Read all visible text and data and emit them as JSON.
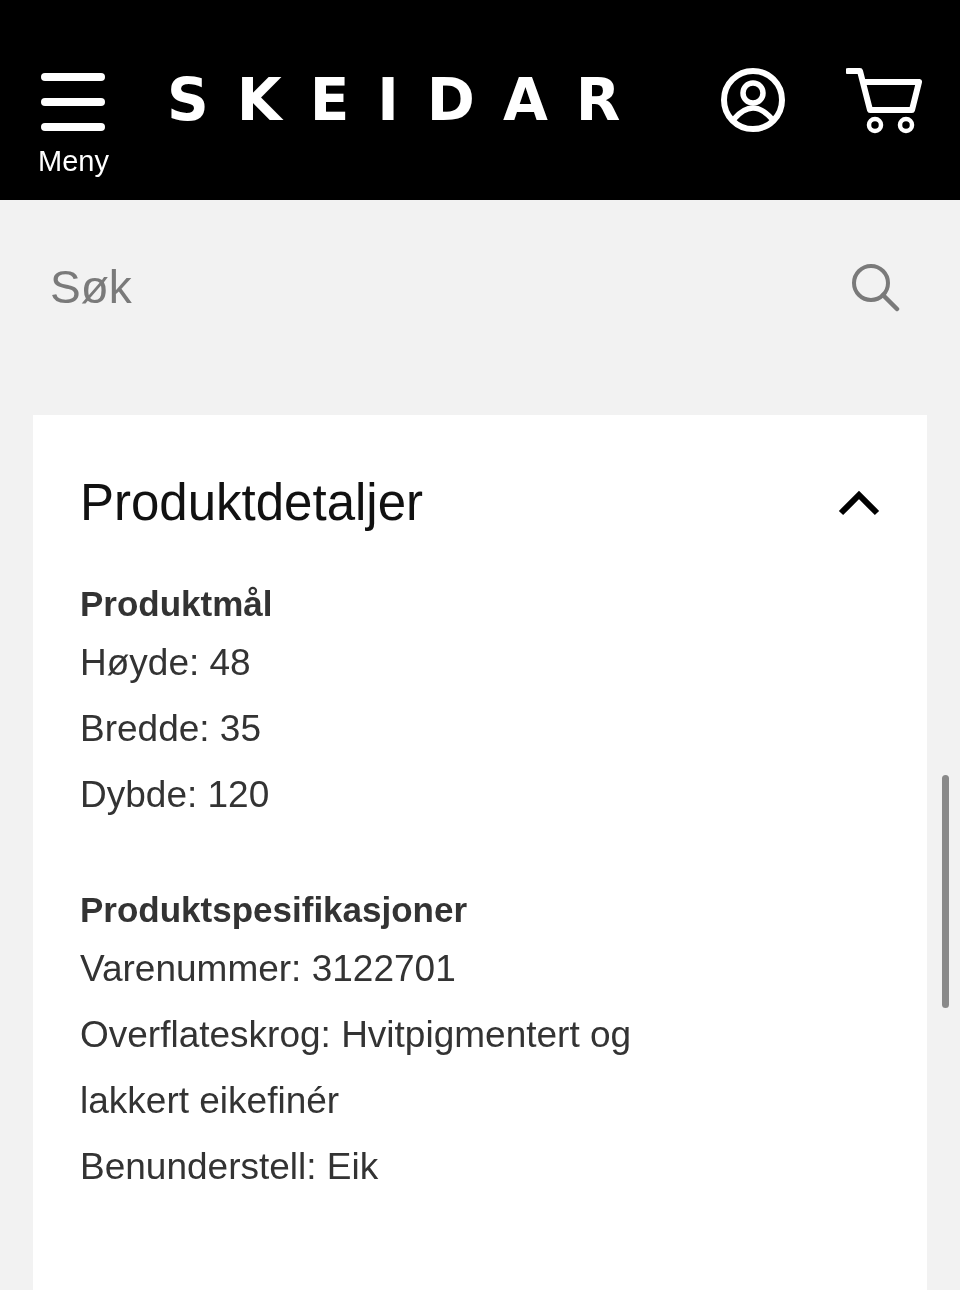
{
  "header": {
    "menu_label": "Meny",
    "logo": "SKEIDAR"
  },
  "search": {
    "placeholder": "Søk"
  },
  "details": {
    "title": "Produktdetaljer",
    "expanded": true,
    "sections": [
      {
        "heading": "Produktmål",
        "lines": [
          "Høyde: 48",
          "Bredde: 35",
          "Dybde: 120"
        ]
      },
      {
        "heading": "Produktspesifikasjoner",
        "lines": [
          "Varenummer: 3122701",
          "Overflateskrog: Hvitpigmentert og lakkert eikefinér",
          "Benunderstell: Eik"
        ]
      }
    ]
  }
}
